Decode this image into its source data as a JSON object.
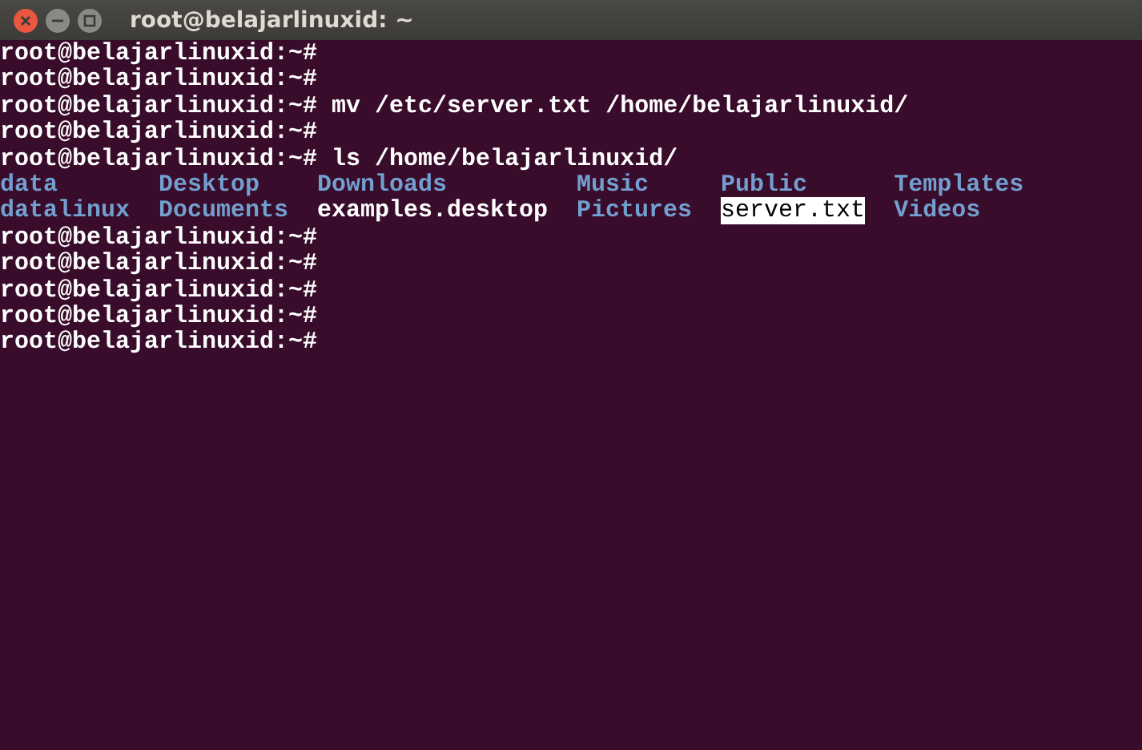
{
  "window": {
    "title": "root@belajarlinuxid: ~"
  },
  "lines": [
    {
      "kind": "prompt",
      "prompt": "root@belajarlinuxid:~#"
    },
    {
      "kind": "prompt",
      "prompt": "root@belajarlinuxid:~#"
    },
    {
      "kind": "prompt",
      "prompt": "root@belajarlinuxid:~#",
      "command": "mv /etc/server.txt /home/belajarlinuxid/"
    },
    {
      "kind": "prompt",
      "prompt": "root@belajarlinuxid:~#"
    },
    {
      "kind": "prompt",
      "prompt": "root@belajarlinuxid:~#",
      "command": "ls /home/belajarlinuxid/"
    },
    {
      "kind": "listing",
      "entries": [
        {
          "name": "data",
          "kind": "dir"
        },
        {
          "name": "Desktop",
          "kind": "dir"
        },
        {
          "name": "Downloads",
          "kind": "dir"
        },
        {
          "name": "Music",
          "kind": "dir"
        },
        {
          "name": "Public",
          "kind": "dir"
        },
        {
          "name": "Templates",
          "kind": "dir"
        }
      ]
    },
    {
      "kind": "listing",
      "entries": [
        {
          "name": "datalinux",
          "kind": "dir"
        },
        {
          "name": "Documents",
          "kind": "dir"
        },
        {
          "name": "examples.desktop",
          "kind": "file"
        },
        {
          "name": "Pictures",
          "kind": "dir"
        },
        {
          "name": "server.txt",
          "kind": "highlighted"
        },
        {
          "name": "Videos",
          "kind": "dir"
        }
      ]
    },
    {
      "kind": "prompt",
      "prompt": "root@belajarlinuxid:~#"
    },
    {
      "kind": "prompt",
      "prompt": "root@belajarlinuxid:~#"
    },
    {
      "kind": "prompt",
      "prompt": "root@belajarlinuxid:~#"
    },
    {
      "kind": "prompt",
      "prompt": "root@belajarlinuxid:~#"
    },
    {
      "kind": "prompt",
      "prompt": "root@belajarlinuxid:~#"
    }
  ]
}
